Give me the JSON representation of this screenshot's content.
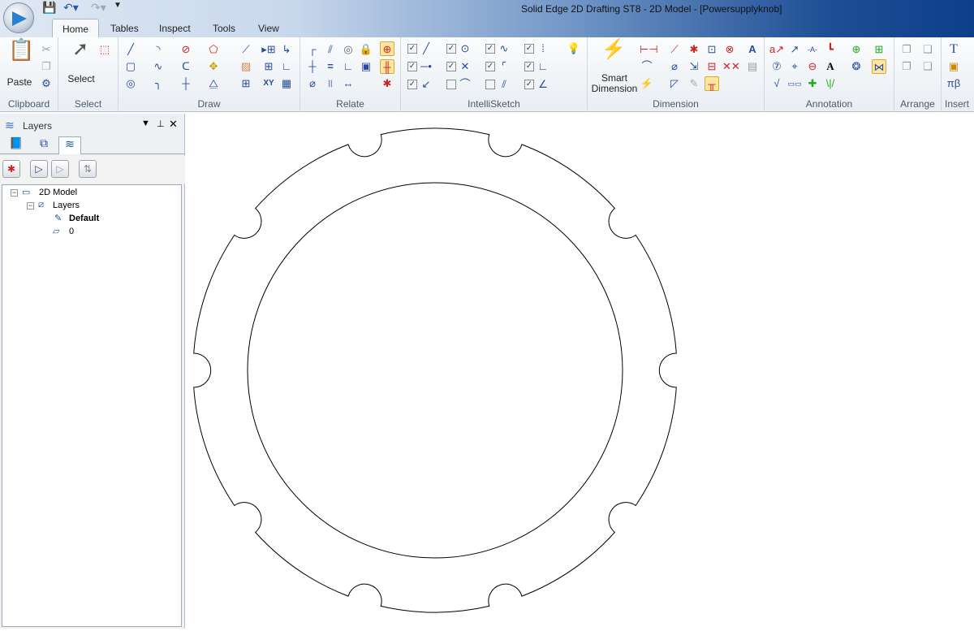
{
  "window": {
    "title": "Solid Edge 2D Drafting ST8 - 2D Model - [Powersupplyknob]"
  },
  "tabs": [
    {
      "label": "Home",
      "active": true
    },
    {
      "label": "Tables"
    },
    {
      "label": "Inspect"
    },
    {
      "label": "Tools"
    },
    {
      "label": "View"
    }
  ],
  "ribbon": {
    "groups": [
      "Clipboard",
      "Select",
      "Draw",
      "Relate",
      "IntelliSketch",
      "Dimension",
      "Annotation",
      "Arrange",
      "Insert"
    ],
    "paste_label": "Paste",
    "select_label": "Select",
    "smart_dimension_label": "Smart\nDimension"
  },
  "panel": {
    "title": "Layers",
    "tree": [
      {
        "label": "2D Model",
        "icon": "model-icon"
      },
      {
        "label": "Layers",
        "icon": "layers-icon"
      },
      {
        "label": "Default",
        "icon": "layer-edit-icon",
        "bold": true
      },
      {
        "label": "0",
        "icon": "layer-icon"
      }
    ]
  },
  "drawing": {
    "part": "knob profile",
    "notch_count": 10
  }
}
